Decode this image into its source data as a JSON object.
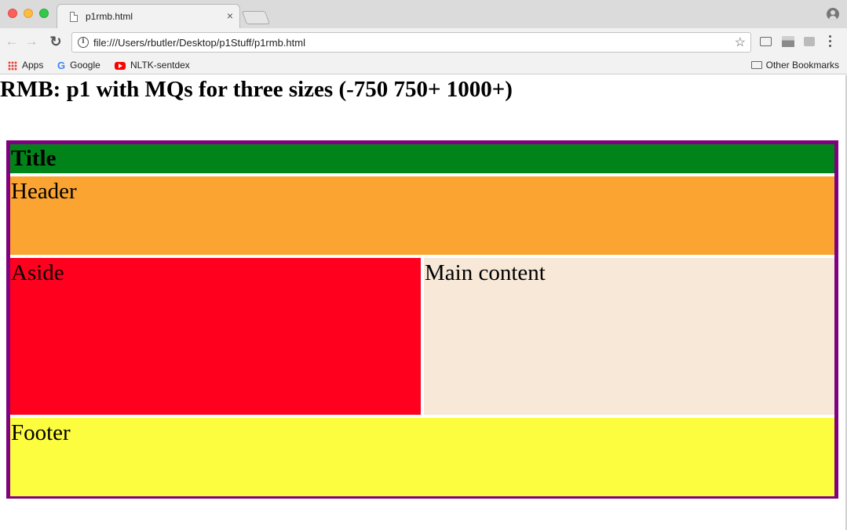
{
  "browser": {
    "tab_title": "p1rmb.html",
    "tab_close": "×",
    "url": "file:///Users/rbutler/Desktop/p1Stuff/p1rmb.html",
    "nav": {
      "back": "←",
      "forward": "→",
      "reload": "↻"
    },
    "info_symbol": "i",
    "star": "☆",
    "bookmarks": [
      {
        "label": "Apps",
        "icon": "apps-grid-icon"
      },
      {
        "label": "Google",
        "icon": "google-icon",
        "icon_glyph": "G"
      },
      {
        "label": "NLTK-sentdex",
        "icon": "youtube-icon"
      }
    ],
    "other_bookmarks": "Other Bookmarks"
  },
  "page": {
    "heading": "RMB: p1 with MQs for three sizes (-750 750+ 1000+)",
    "layout": {
      "title": "Title",
      "header": "Header",
      "aside": "Aside",
      "main": "Main content",
      "footer": "Footer"
    },
    "colors": {
      "border": "#800080",
      "title": "#008419",
      "header": "#fba431",
      "aside": "#ff001f",
      "main": "#f7e8d8",
      "footer": "#fcfd3e"
    }
  }
}
